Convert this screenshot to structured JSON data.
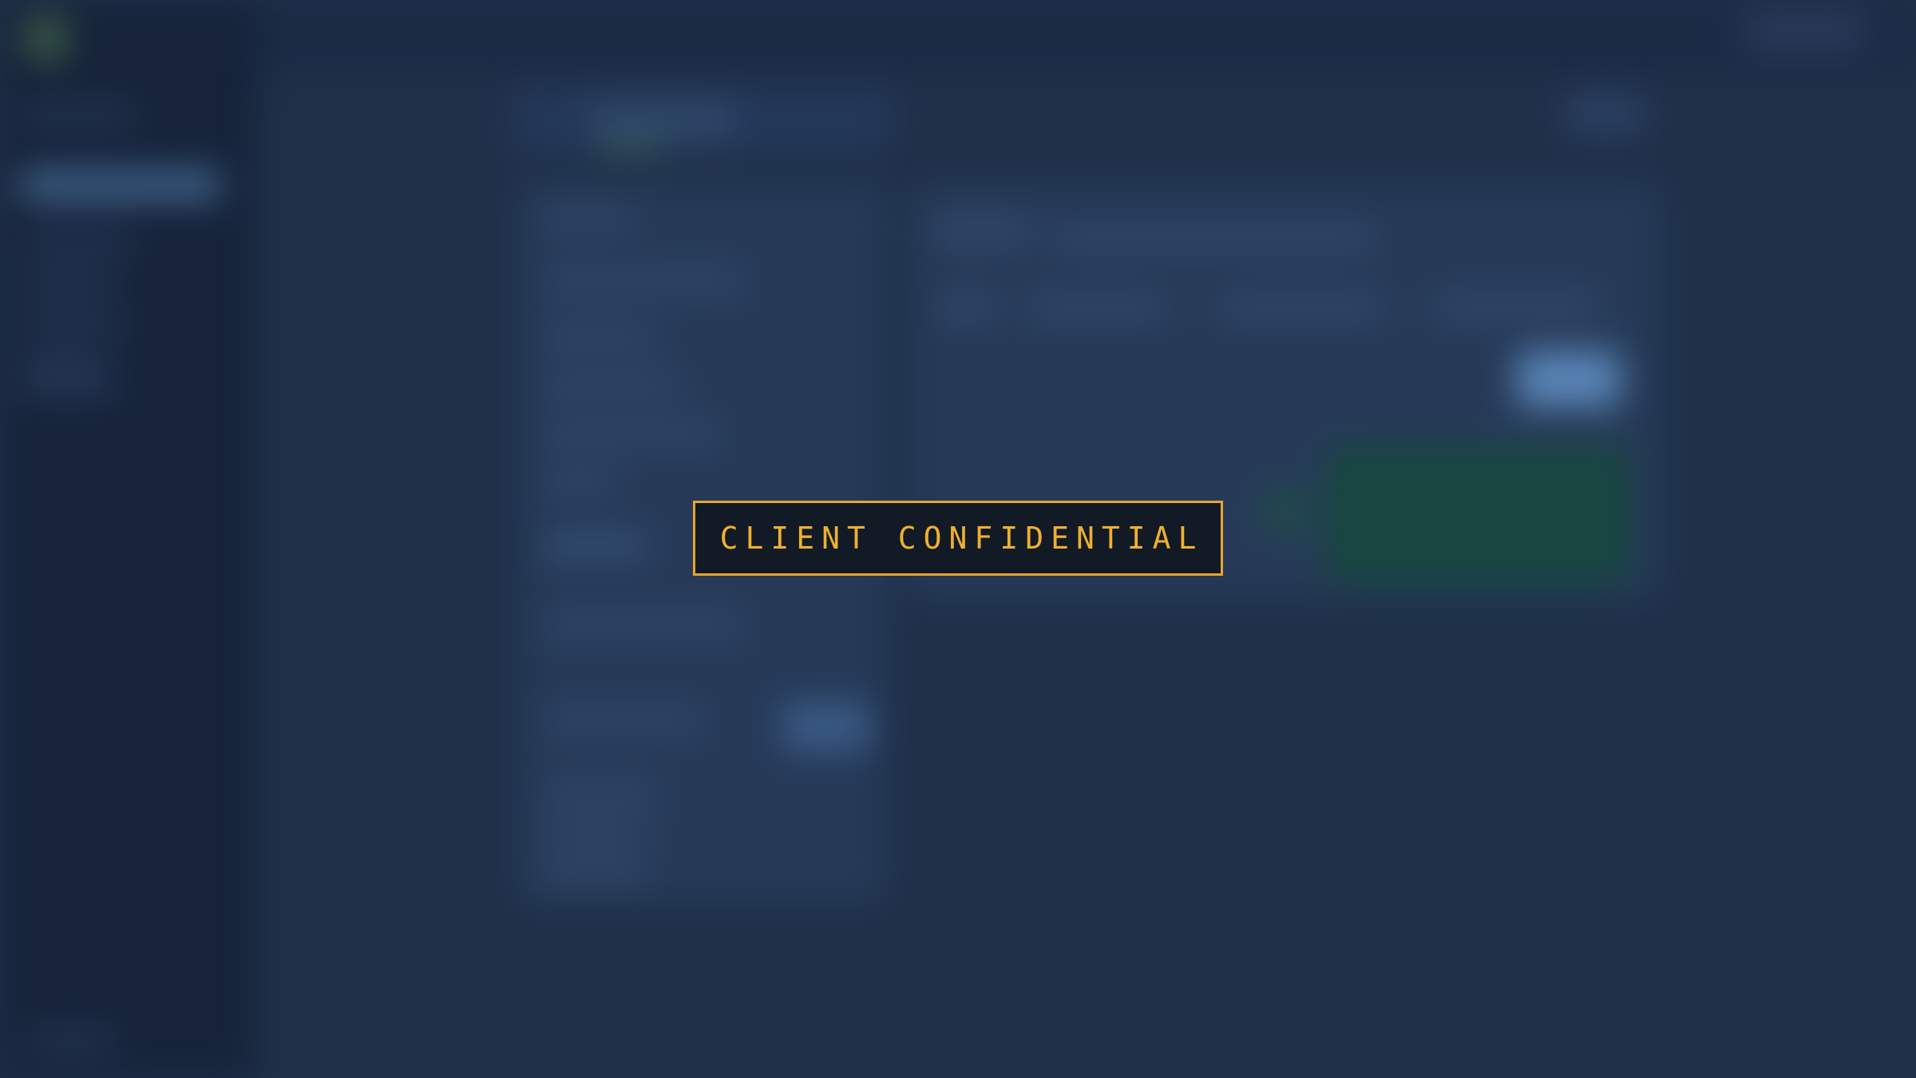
{
  "overlay": {
    "label": "CLIENT CONFIDENTIAL"
  },
  "colors": {
    "background": "#1f3049",
    "sidebar": "#16233a",
    "overlay_border": "#e8a62a",
    "overlay_text": "#f0b02f",
    "overlay_fill": "#121a26",
    "accent_blue": "#5a86b8",
    "accent_green": "#17473f"
  }
}
